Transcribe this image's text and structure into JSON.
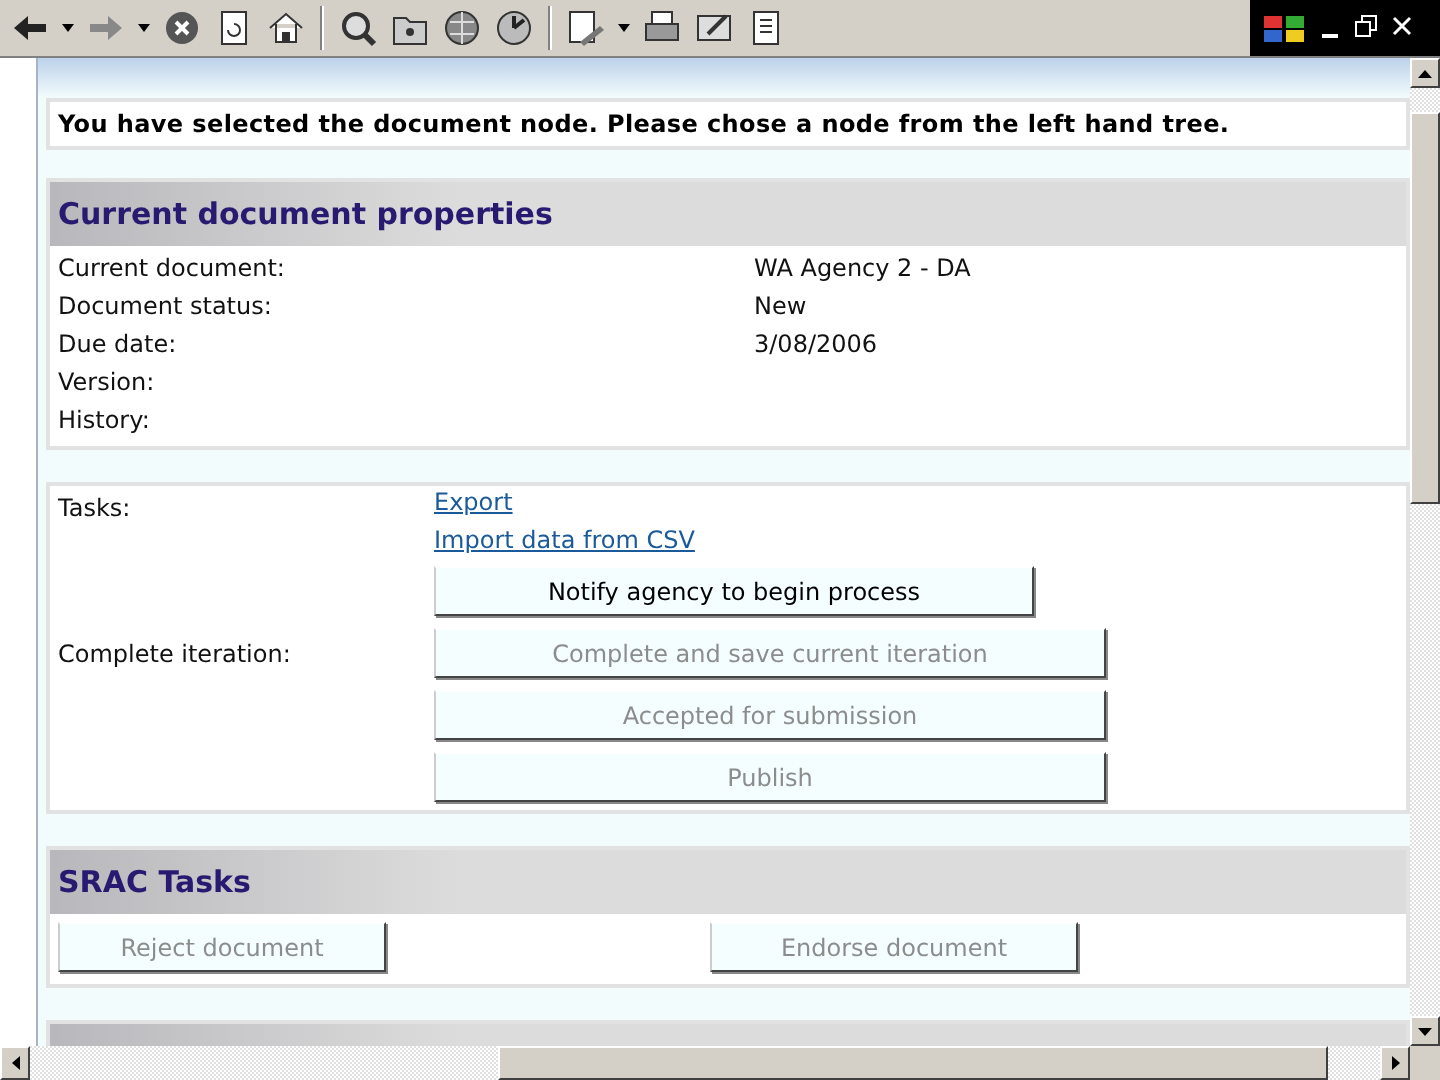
{
  "message": "You have selected the document node. Please chose a node from the left hand tree.",
  "properties": {
    "title": "Current document properties",
    "rows": [
      {
        "label": "Current document:",
        "value": "WA Agency 2 - DA"
      },
      {
        "label": "Document status:",
        "value": "New"
      },
      {
        "label": "Due date:",
        "value": "3/08/2006"
      },
      {
        "label": "Version:"
      },
      {
        "label": "History:"
      }
    ]
  },
  "tasks": [
    {
      "label": "Tasks:",
      "actions": [
        {
          "kind": "link",
          "text": "Export"
        },
        {
          "kind": "link",
          "text": "Import data from CSV"
        },
        {
          "kind": "button",
          "text": "Notify agency to begin process",
          "disabled": false
        }
      ]
    },
    {
      "label": "Complete iteration:",
      "actions": [
        {
          "kind": "button",
          "text": "Complete and save current iteration",
          "disabled": true
        },
        {
          "kind": "button",
          "text": "Accepted for submission",
          "disabled": true
        },
        {
          "kind": "button",
          "text": "Publish",
          "disabled": true
        }
      ]
    }
  ],
  "srac": {
    "title": "SRAC Tasks",
    "buttons": [
      {
        "text": "Reject document",
        "disabled": true
      },
      {
        "text": "Endorse document",
        "disabled": true
      }
    ]
  }
}
